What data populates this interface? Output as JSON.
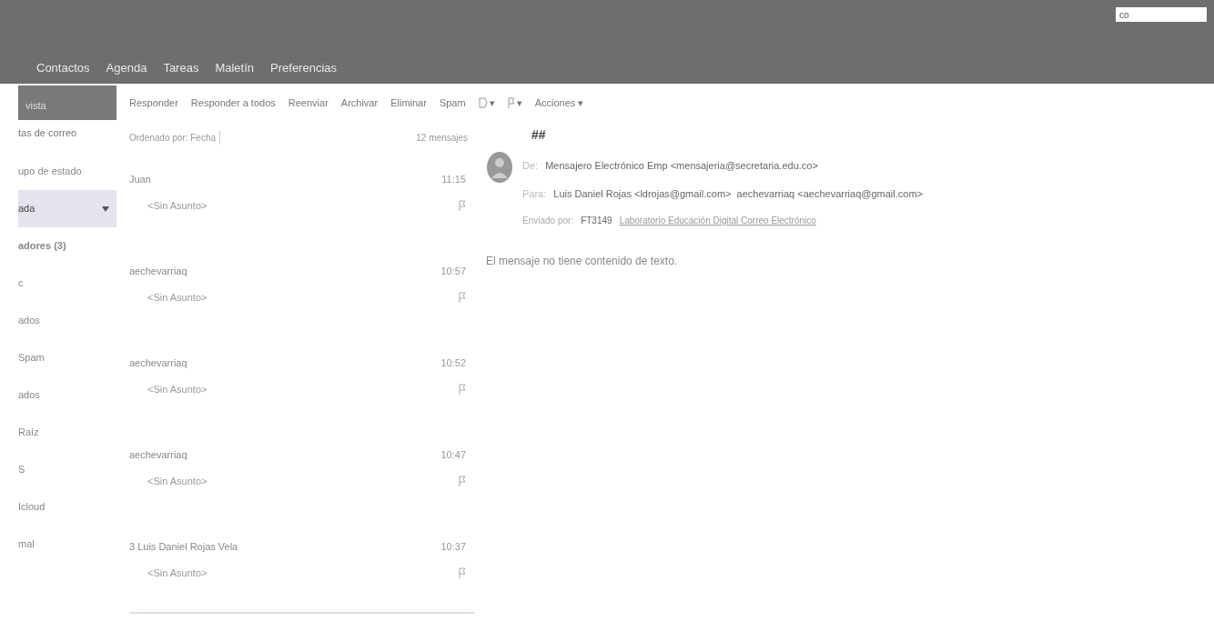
{
  "header": {
    "search": {
      "value": "co"
    },
    "tabs": [
      {
        "label": "Contactos",
        "selected": false
      },
      {
        "label": "Agenda",
        "selected": false
      },
      {
        "label": "Tareas",
        "selected": false
      },
      {
        "label": "Maletín",
        "selected": false
      },
      {
        "label": "Preferencias",
        "selected": false
      }
    ]
  },
  "toolbar": {
    "selector": {
      "label": "vista"
    },
    "buttons": [
      {
        "label": "Responder",
        "kind": "text"
      },
      {
        "label": "Responder a todos",
        "kind": "text"
      },
      {
        "label": "Reenviar",
        "kind": "text"
      },
      {
        "label": "Archivar",
        "kind": "text"
      },
      {
        "label": "Eliminar",
        "kind": "text"
      },
      {
        "label": "Spam",
        "kind": "text"
      },
      {
        "label": "▾",
        "kind": "tag"
      },
      {
        "label": "▾",
        "kind": "flag"
      },
      {
        "label": "Acciones ▾",
        "kind": "text"
      }
    ]
  },
  "sidebar": {
    "heading": "tas de correo",
    "items": [
      {
        "label": "upo de estado",
        "selected": false,
        "bold": false
      },
      {
        "label": "ada",
        "selected": true,
        "bold": false
      },
      {
        "label": "adores (3)",
        "selected": false,
        "bold": true
      },
      {
        "label": "c",
        "selected": false,
        "bold": false
      },
      {
        "label": "ados",
        "selected": false,
        "bold": false
      },
      {
        "label": "Spam",
        "selected": false,
        "bold": false
      },
      {
        "label": "ados",
        "selected": false,
        "bold": false
      },
      {
        "label": "Raíz",
        "selected": false,
        "bold": false
      },
      {
        "label": "S",
        "selected": false,
        "bold": false
      },
      {
        "label": "Icloud",
        "selected": false,
        "bold": false
      },
      {
        "label": "mal",
        "selected": false,
        "bold": false
      }
    ]
  },
  "message_list": {
    "sort": "Ordenado por: Fecha",
    "count": "12 mensajes",
    "rows": [
      {
        "sender": "Juan",
        "subject": "<Sin Asunto>",
        "time": "11:15"
      },
      {
        "sender": "aechevarriaq",
        "subject": "<Sin Asunto>",
        "time": "10:57"
      },
      {
        "sender": "aechevarriaq",
        "subject": "<Sin Asunto>",
        "time": "10:52"
      },
      {
        "sender": "aechevarriaq",
        "subject": "<Sin Asunto>",
        "time": "10:47"
      },
      {
        "sender": "3 Luis Daniel Rojas Vela",
        "subject": "<Sin Asunto>",
        "time": "10:37"
      }
    ]
  },
  "reading_pane": {
    "title": "##",
    "from_label": "De:",
    "from": "Mensajero Electrónico Emp <mensajeria@secretaria.edu.co>",
    "to_label": "Para:",
    "to": "Luis Daniel Rojas <ldrojas@gmail.com>  aechevarriaq <aechevarriaq@gmail.com>",
    "sent_note": "Enviado por:",
    "sent_id": "FT3149",
    "sent_link": "Laboratorio Educación Digital Correo Electrónico",
    "body": "El mensaje no tiene contenido de texto."
  }
}
